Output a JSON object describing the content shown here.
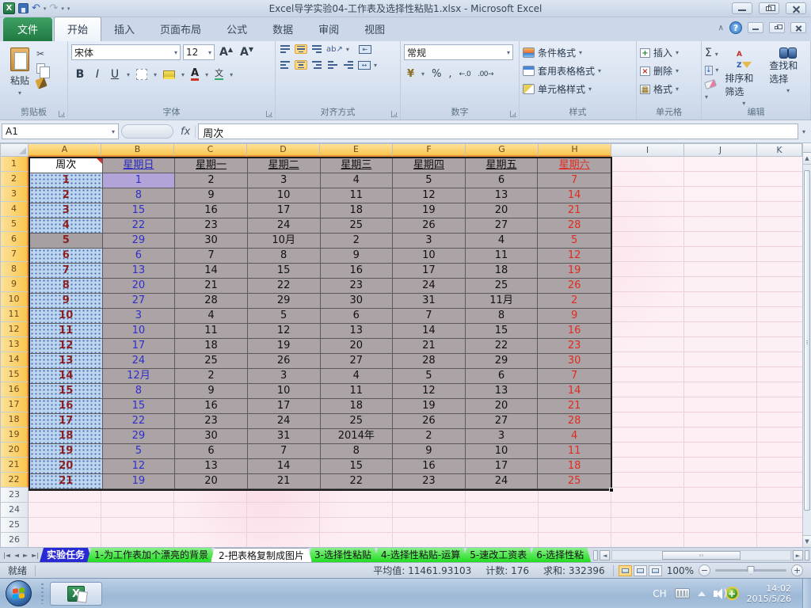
{
  "window": {
    "title": "Excel导学实验04-工作表及选择性粘贴1.xlsx - Microsoft Excel"
  },
  "ribbon": {
    "tabs": [
      {
        "label": "文件",
        "type": "file"
      },
      {
        "label": "开始",
        "type": "active"
      },
      {
        "label": "插入",
        "type": "normal"
      },
      {
        "label": "页面布局",
        "type": "normal"
      },
      {
        "label": "公式",
        "type": "normal"
      },
      {
        "label": "数据",
        "type": "normal"
      },
      {
        "label": "审阅",
        "type": "normal"
      },
      {
        "label": "视图",
        "type": "normal"
      }
    ],
    "paste_label": "粘贴",
    "font_name": "宋体",
    "font_size": "12",
    "number_format": "常规",
    "group_labels": {
      "clipboard": "剪贴板",
      "font": "字体",
      "alignment": "对齐方式",
      "number": "数字",
      "style": "样式",
      "cells": "单元格",
      "editing": "编辑"
    },
    "style_items": [
      "条件格式",
      "套用表格格式",
      "单元格样式"
    ],
    "cells_items": [
      "插入",
      "删除",
      "格式"
    ],
    "sort_filter_label": "排序和筛选",
    "find_select_label": "查找和选择"
  },
  "formula_bar": {
    "name_box": "A1",
    "fx": "fx",
    "content": "周次"
  },
  "grid": {
    "columns": [
      "A",
      "B",
      "C",
      "D",
      "E",
      "F",
      "G",
      "H",
      "I",
      "J",
      "K"
    ],
    "selected_columns": [
      "A",
      "B",
      "C",
      "D",
      "E",
      "F",
      "G",
      "H"
    ],
    "row_count": 26,
    "selected_row_count": 22,
    "colors": {
      "header_text": [
        "#000000",
        "#2727c3",
        "#111111",
        "#111111",
        "#111111",
        "#111111",
        "#111111",
        "#e02b20"
      ],
      "value_text": [
        "#8b2020",
        "#2f2fc8",
        "#111111",
        "#111111",
        "#111111",
        "#111111",
        "#111111",
        "#e02b20"
      ]
    },
    "table": {
      "headers": [
        "周次",
        "星期日",
        "星期一",
        "星期二",
        "星期三",
        "星期四",
        "星期五",
        "星期六"
      ],
      "weeks": [
        [
          "1",
          "1",
          "2",
          "3",
          "4",
          "5",
          "6",
          "7"
        ],
        [
          "2",
          "8",
          "9",
          "10",
          "11",
          "12",
          "13",
          "14"
        ],
        [
          "3",
          "15",
          "16",
          "17",
          "18",
          "19",
          "20",
          "21"
        ],
        [
          "4",
          "22",
          "23",
          "24",
          "25",
          "26",
          "27",
          "28"
        ],
        [
          "5",
          "29",
          "30",
          "10月",
          "2",
          "3",
          "4",
          "5"
        ],
        [
          "6",
          "6",
          "7",
          "8",
          "9",
          "10",
          "11",
          "12"
        ],
        [
          "7",
          "13",
          "14",
          "15",
          "16",
          "17",
          "18",
          "19"
        ],
        [
          "8",
          "20",
          "21",
          "22",
          "23",
          "24",
          "25",
          "26"
        ],
        [
          "9",
          "27",
          "28",
          "29",
          "30",
          "31",
          "11月",
          "2"
        ],
        [
          "10",
          "3",
          "4",
          "5",
          "6",
          "7",
          "8",
          "9"
        ],
        [
          "11",
          "10",
          "11",
          "12",
          "13",
          "14",
          "15",
          "16"
        ],
        [
          "12",
          "17",
          "18",
          "19",
          "20",
          "21",
          "22",
          "23"
        ],
        [
          "13",
          "24",
          "25",
          "26",
          "27",
          "28",
          "29",
          "30"
        ],
        [
          "14",
          "12月",
          "2",
          "3",
          "4",
          "5",
          "6",
          "7"
        ],
        [
          "15",
          "8",
          "9",
          "10",
          "11",
          "12",
          "13",
          "14"
        ],
        [
          "16",
          "15",
          "16",
          "17",
          "18",
          "19",
          "20",
          "21"
        ],
        [
          "17",
          "22",
          "23",
          "24",
          "25",
          "26",
          "27",
          "28"
        ],
        [
          "18",
          "29",
          "30",
          "31",
          "2014年",
          "2",
          "3",
          "4"
        ],
        [
          "19",
          "5",
          "6",
          "7",
          "8",
          "9",
          "10",
          "11"
        ],
        [
          "20",
          "12",
          "13",
          "14",
          "15",
          "16",
          "17",
          "18"
        ],
        [
          "21",
          "19",
          "20",
          "21",
          "22",
          "23",
          "24",
          "25"
        ]
      ],
      "purple_cell": {
        "week_index": 0,
        "col_index": 1
      },
      "plain_a_week_index": 4
    }
  },
  "sheet_tabs": [
    {
      "label": "实验任务",
      "style": "blue"
    },
    {
      "label": "1-为工作表加个漂亮的背景",
      "style": "green"
    },
    {
      "label": "2-把表格复制成图片",
      "style": "active"
    },
    {
      "label": "3-选择性粘贴",
      "style": "green"
    },
    {
      "label": "4-选择性粘贴-运算",
      "style": "green"
    },
    {
      "label": "5-速改工资表",
      "style": "green"
    },
    {
      "label": "6-选择性粘",
      "style": "green clipped"
    }
  ],
  "status_bar": {
    "mode": "就绪",
    "average": "平均值: 11461.93103",
    "count": "计数: 176",
    "sum": "求和: 332396",
    "zoom": "100%"
  },
  "taskbar": {
    "lang": "CH",
    "time": "14:02",
    "date": "2015/5/26"
  }
}
